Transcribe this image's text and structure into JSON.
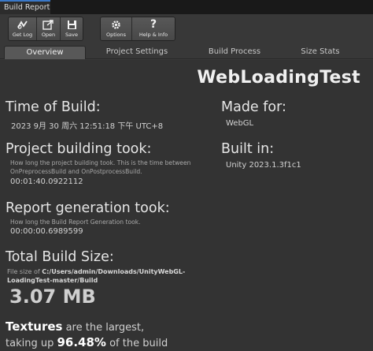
{
  "window": {
    "tab_title": "Build Report"
  },
  "toolbar": {
    "get_log": "Get Log",
    "open": "Open",
    "save": "Save",
    "options": "Options",
    "help_info": "Help & Info"
  },
  "tabs": [
    "Overview",
    "Project Settings",
    "Build Process",
    "Size Stats"
  ],
  "overview": {
    "project_name": "WebLoadingTest",
    "time_of_build": {
      "heading": "Time of Build:",
      "value": "2023 9月 30 周六 12:51:18 下午 UTC+8"
    },
    "made_for": {
      "heading": "Made for:",
      "value": "WebGL"
    },
    "build_duration": {
      "heading": "Project building took:",
      "desc_line1": "How long the project building took. This is the time between",
      "desc_line2": "OnPreprocessBuild and OnPostprocessBuild.",
      "value": "00:01:40.0922112"
    },
    "built_in": {
      "heading": "Built in:",
      "value": "Unity 2023.1.3f1c1"
    },
    "report_generation": {
      "heading": "Report generation took:",
      "desc": "How long the Build Report Generation took.",
      "value": "00:00:00.6989599"
    },
    "total_size": {
      "heading": "Total Build Size:",
      "prefix": "File size of",
      "path_line1": "C:/Users/admin/Downloads/UnityWebGL-",
      "path_line2": "LoadingTest-master/Build",
      "value": "3.07 MB"
    },
    "largest": {
      "category": "Textures",
      "text1": "are the largest,",
      "text2": "taking up",
      "percent": "96.48%",
      "text3": "of the build"
    }
  }
}
